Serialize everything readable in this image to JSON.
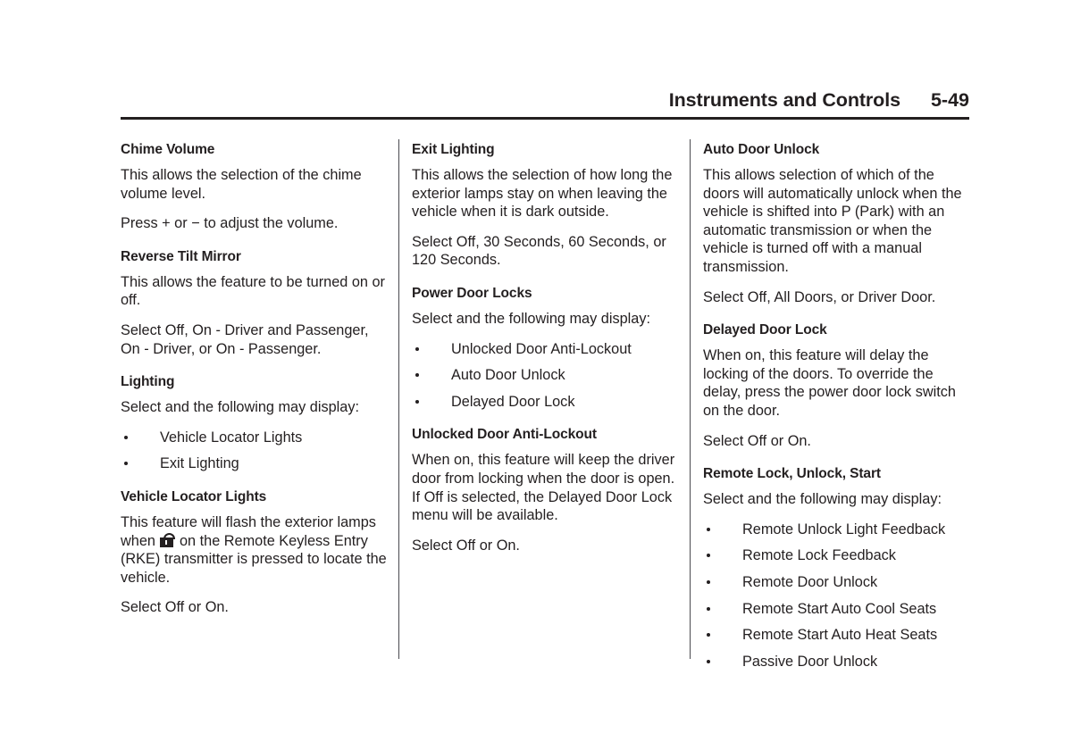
{
  "header": {
    "title": "Instruments and Controls",
    "folio": "5-49"
  },
  "icons": {
    "unlock": "unlock-padlock-icon"
  },
  "columns": [
    {
      "id": "column-1",
      "blocks": [
        {
          "type": "subhead",
          "text": "Chime Volume"
        },
        {
          "type": "body",
          "text": "This allows the selection of the chime volume level."
        },
        {
          "type": "body",
          "text": "Press + or − to adjust the volume."
        },
        {
          "type": "subhead",
          "text": "Reverse Tilt Mirror"
        },
        {
          "type": "body",
          "text": "This allows the feature to be turned on or off."
        },
        {
          "type": "body",
          "text": "Select Off, On - Driver and Passenger, On - Driver, or On - Passenger."
        },
        {
          "type": "subhead",
          "text": "Lighting"
        },
        {
          "type": "body",
          "text": "Select and the following may display:"
        },
        {
          "type": "bullets",
          "items": [
            "Vehicle Locator Lights",
            "Exit Lighting"
          ]
        },
        {
          "type": "subhead",
          "text": "Vehicle Locator Lights"
        },
        {
          "type": "body-with-icon",
          "text_before": "This feature will flash the exterior lamps when ",
          "icon": "unlock-padlock-icon",
          "text_after": " on the Remote Keyless Entry (RKE) transmitter is pressed to locate the vehicle."
        },
        {
          "type": "body",
          "text": "Select Off or On."
        }
      ]
    },
    {
      "id": "column-2",
      "blocks": [
        {
          "type": "subhead",
          "text": "Exit Lighting"
        },
        {
          "type": "body",
          "text": "This allows the selection of how long the exterior lamps stay on when leaving the vehicle when it is dark outside."
        },
        {
          "type": "body",
          "text": "Select Off, 30 Seconds, 60 Seconds, or 120 Seconds."
        },
        {
          "type": "subhead",
          "text": "Power Door Locks"
        },
        {
          "type": "body",
          "text": "Select and the following may display:"
        },
        {
          "type": "bullets",
          "items": [
            "Unlocked Door Anti-Lockout",
            "Auto Door Unlock",
            "Delayed Door Lock"
          ]
        },
        {
          "type": "subhead",
          "text": "Unlocked Door Anti-Lockout"
        },
        {
          "type": "body",
          "text": "When on, this feature will keep the driver door from locking when the door is open. If Off is selected, the Delayed Door Lock menu will be available."
        },
        {
          "type": "body",
          "text": "Select Off or On."
        }
      ]
    },
    {
      "id": "column-3",
      "blocks": [
        {
          "type": "subhead",
          "text": "Auto Door Unlock"
        },
        {
          "type": "body",
          "text": "This allows selection of which of the doors will automatically unlock when the vehicle is shifted into P (Park) with an automatic transmission or when the vehicle is turned off with a manual transmission."
        },
        {
          "type": "body",
          "text": "Select Off, All Doors, or Driver Door."
        },
        {
          "type": "subhead",
          "text": "Delayed Door Lock"
        },
        {
          "type": "body",
          "text": "When on, this feature will delay the locking of the doors. To override the delay, press the power door lock switch on the door."
        },
        {
          "type": "body",
          "text": "Select Off or On."
        },
        {
          "type": "subhead",
          "text": "Remote Lock, Unlock, Start"
        },
        {
          "type": "body",
          "text": "Select and the following may display:"
        },
        {
          "type": "bullets",
          "items": [
            "Remote Unlock Light Feedback",
            "Remote Lock Feedback",
            "Remote Door Unlock",
            "Remote Start Auto Cool Seats",
            "Remote Start Auto Heat Seats",
            "Passive Door Unlock"
          ]
        }
      ]
    }
  ],
  "colors": {
    "text": "#231f20",
    "rule": "#231f20",
    "divider": "#4a4a4f",
    "background": "#ffffff"
  }
}
